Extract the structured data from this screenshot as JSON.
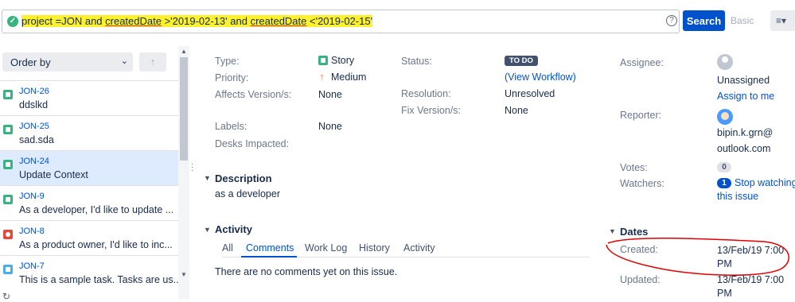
{
  "search": {
    "jql_before": "project =JON and ",
    "jql_field1": "createdDate",
    "jql_mid": " >'2019-02-13' and ",
    "jql_field2": "createdDate",
    "jql_after": " <'2019-02-15'",
    "check_icon": "check-circle-icon",
    "help_icon": "?",
    "search_label": "Search",
    "basic_label": "Basic",
    "layout_icon": "≡▾",
    "highlight_color": "#fdf12e"
  },
  "list": {
    "order_by_label": "Order by",
    "order_chevron": "⌄",
    "sort_icon": "↑",
    "items": [
      {
        "key": "JON-26",
        "summary": "ddslkd",
        "type": "story"
      },
      {
        "key": "JON-25",
        "summary": "sad.sda",
        "type": "story"
      },
      {
        "key": "JON-24",
        "summary": "Update Context",
        "type": "story",
        "selected": true
      },
      {
        "key": "JON-9",
        "summary": "As a developer, I'd like to update ...",
        "type": "story"
      },
      {
        "key": "JON-8",
        "summary": "As a product owner, I'd like to inc...",
        "type": "bug"
      },
      {
        "key": "JON-7",
        "summary": "This is a sample task. Tasks are us...",
        "type": "task"
      }
    ]
  },
  "details": {
    "type_label": "Type:",
    "type_value": "Story",
    "priority_label": "Priority:",
    "priority_value": "Medium",
    "affects_label": "Affects Version/s:",
    "affects_value": "None",
    "labels_label": "Labels:",
    "labels_value": "None",
    "desks_label": "Desks Impacted:",
    "status_label": "Status:",
    "status_value": "TO DO",
    "workflow_link": "(View Workflow)",
    "resolution_label": "Resolution:",
    "resolution_value": "Unresolved",
    "fix_label": "Fix Version/s:",
    "fix_value": "None"
  },
  "description": {
    "heading": "Description",
    "text": "as a developer"
  },
  "activity": {
    "heading": "Activity",
    "tabs": [
      "All",
      "Comments",
      "Work Log",
      "History",
      "Activity"
    ],
    "active_tab": "Comments",
    "empty_text": "There are no comments yet on this issue."
  },
  "people": {
    "assignee_label": "Assignee:",
    "assignee_value": "Unassigned",
    "assign_link": "Assign to me",
    "reporter_label": "Reporter:",
    "reporter_line1": "bipin.k.grn@",
    "reporter_line2": "outlook.com",
    "votes_label": "Votes:",
    "votes_count": "0",
    "watchers_label": "Watchers:",
    "watchers_count": "1",
    "watch_link_line1": "Stop watching",
    "watch_link_line2": "this issue"
  },
  "dates": {
    "heading": "Dates",
    "created_label": "Created:",
    "created_line1": "13/Feb/19 7:00",
    "created_line2": "PM",
    "updated_label": "Updated:",
    "updated_line1": "13/Feb/19 7:00",
    "updated_line2": "PM",
    "annotation_color": "#e00000"
  }
}
